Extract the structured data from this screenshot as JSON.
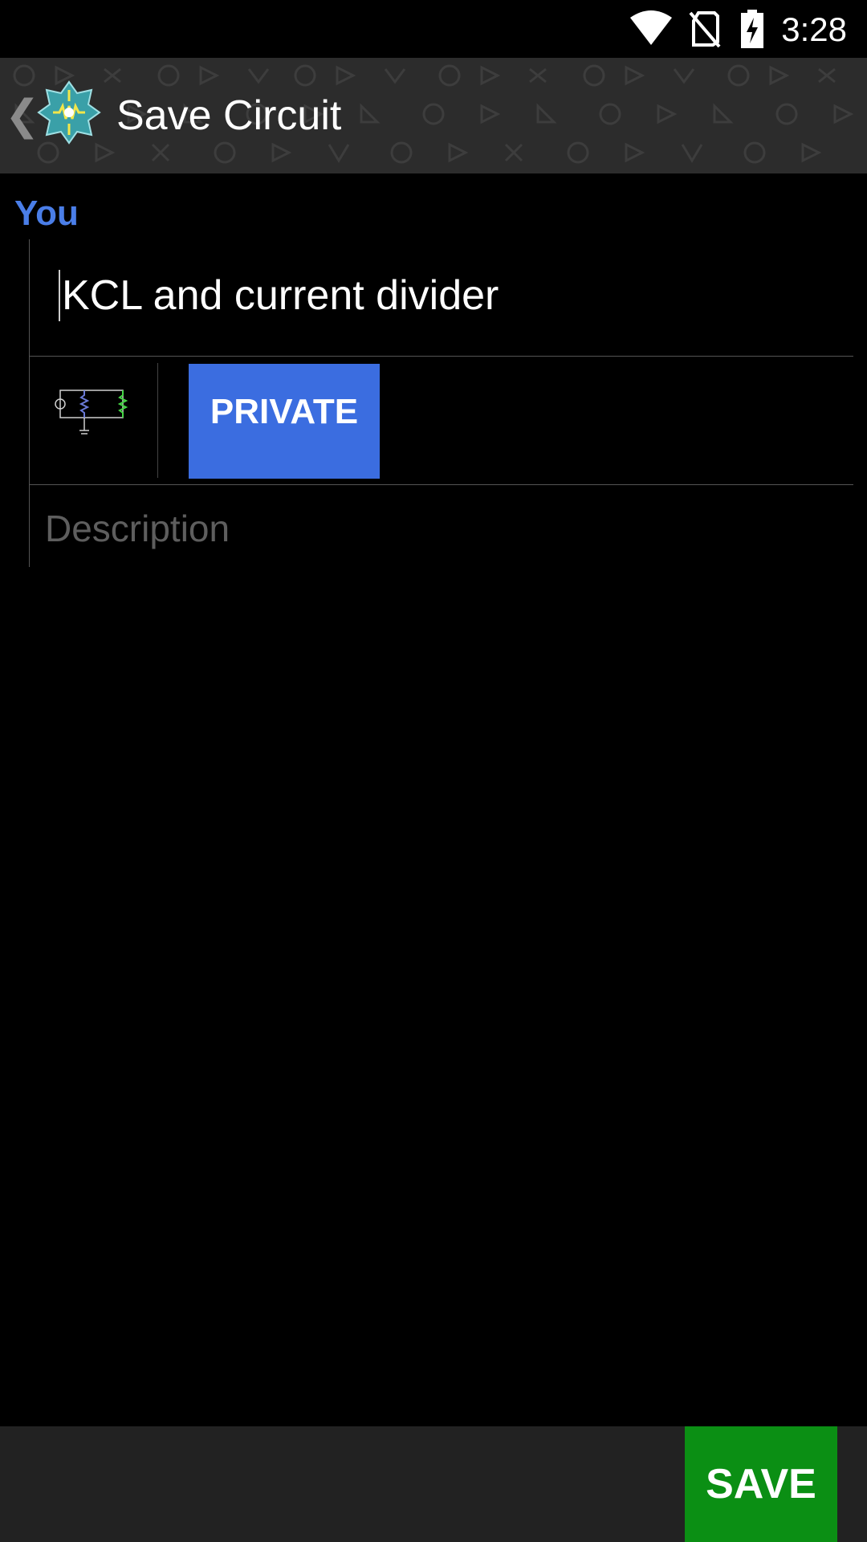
{
  "status_bar": {
    "time": "3:28",
    "icons": [
      "wifi-icon",
      "no-sim-icon",
      "battery-charging-icon"
    ]
  },
  "app_bar": {
    "back_icon": "chevron-left-icon",
    "logo_icon": "circuit-app-logo-icon",
    "title": "Save Circuit"
  },
  "form": {
    "section_label": "You",
    "title_value": "KCL and current divider",
    "visibility_button": "PRIVATE",
    "description_placeholder": "Description",
    "thumbnail_icon": "circuit-thumbnail-icon"
  },
  "footer": {
    "save_label": "SAVE"
  },
  "colors": {
    "accent_blue": "#3b6de0",
    "label_blue": "#4a7ee8",
    "save_green": "#0b8f14",
    "app_bar": "#2c2c2c",
    "bottom_bar": "#222222"
  }
}
